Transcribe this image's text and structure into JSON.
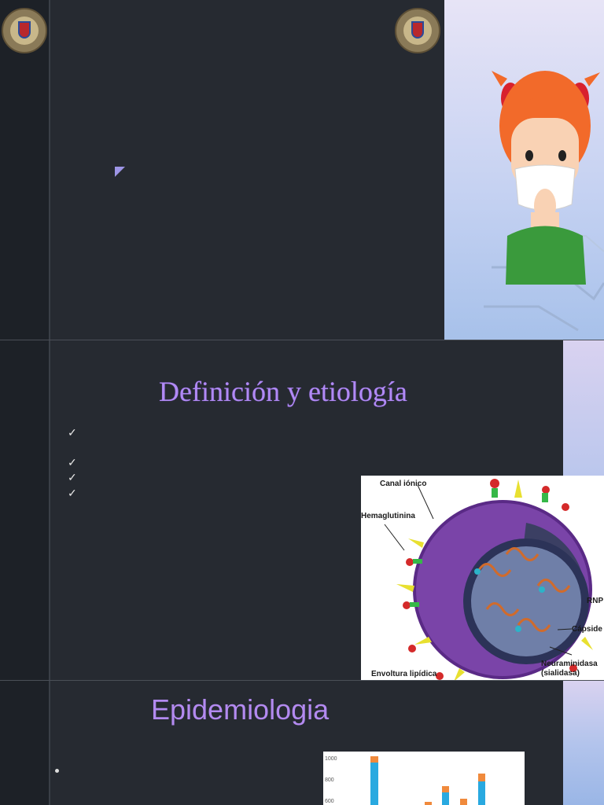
{
  "slides": [
    {
      "id": "slide-1"
    },
    {
      "id": "slide-2",
      "title": "Definición y etiología",
      "figure_labels": {
        "canal": "Canal iónico",
        "hemaglutinina": "Hemaglutinina",
        "rnp": "RNP",
        "capside": "Cápside",
        "neuraminidasa": "Neuraminidasa",
        "sialidasa": "(sialidasa)",
        "envoltura": "Envoltura lipídica"
      }
    },
    {
      "id": "slide-3",
      "title": "Epidemiologia",
      "chart_data": {
        "type": "bar",
        "yticks": [
          "1000",
          "800",
          "600"
        ]
      }
    }
  ],
  "colors": {
    "accent": "#b18af5",
    "background": "#262a31",
    "panel": "#1d2127"
  }
}
